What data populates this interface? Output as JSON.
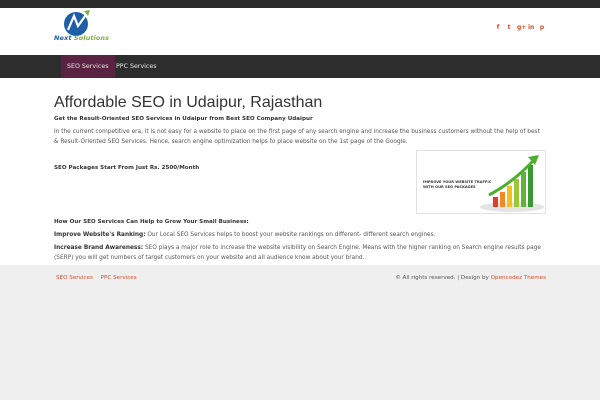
{
  "header": {
    "logo_text_a": "Next",
    "logo_text_b": " Solutions",
    "social": [
      "f",
      "t",
      "g+",
      "in",
      "p"
    ]
  },
  "nav": {
    "items": [
      {
        "label": "SEO Services",
        "active": true
      },
      {
        "label": "PPC Services",
        "active": false
      }
    ]
  },
  "main": {
    "title": "Affordable SEO in Udaipur, Rajasthan",
    "subtitle": "Get the Result-Oriented SEO Services in Udaipur from Best SEO Company Udaipur",
    "intro": "In the current competitive era, it is not easy for a website to place on the first page of any search engine and increase the business customers without the help of best & Result-Oriented SEO Services. Hence, search engine optimization helps to place website on the 1st page of the Google.",
    "packages": "SEO Packages Start From Just Rs. 2500/Month",
    "promo_line1": "IMPROVE YOUR WEBSITE TRAFFIC",
    "promo_line2": "WITH OUR SEO PACKAGES",
    "how_heading": "How Our SEO Services Can Help to Grow Your Small Business:",
    "point1_label": "Improve Website's Ranking:",
    "point1_text": " Our Local SEO Services helps to boost your website rankings on different- different search engines.",
    "point2_label": "Increase Brand Awareness:",
    "point2_text": " SEO plays a major role to increase the website visibility on Search Engine. Means with the higher ranking on Search engine results page (SERP) you will get numbers of target customers on your website and all audience know about your brand."
  },
  "footer": {
    "links": [
      "SEO Services",
      "PPC Services"
    ],
    "copyright": "© All rights reserved. | Design by ",
    "designer": "Opencodez Themes"
  },
  "colors": {
    "accent": "#d0502e",
    "nav_active": "#5a2342",
    "nav_bg": "#2d2d2d"
  }
}
